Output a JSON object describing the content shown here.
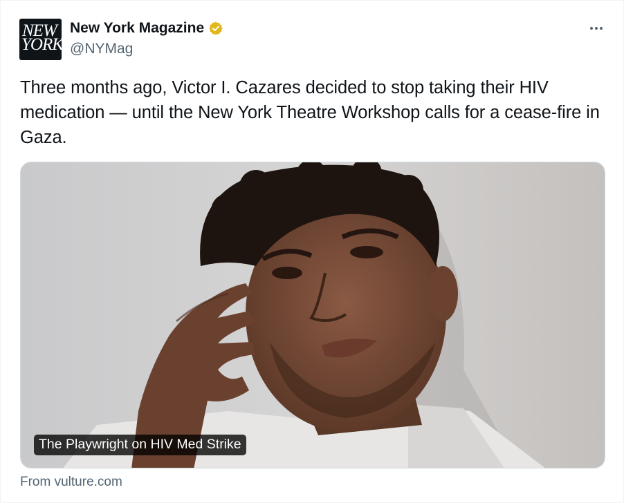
{
  "account": {
    "name": "New York Magazine",
    "handle": "@NYMag",
    "logo_line1": "NEW",
    "logo_line2": "YORK",
    "verified_color": "#e2b719"
  },
  "tweet": {
    "text": "Three months ago, Victor I. Cazares decided to stop taking their HIV medication — until the New York Theatre Workshop calls for a cease-fire in Gaza."
  },
  "card": {
    "caption": "The Playwright on HIV Med Strike",
    "source": "From vulture.com"
  },
  "icons": {
    "verified": "verified-badge-icon",
    "more": "more-options-icon"
  }
}
